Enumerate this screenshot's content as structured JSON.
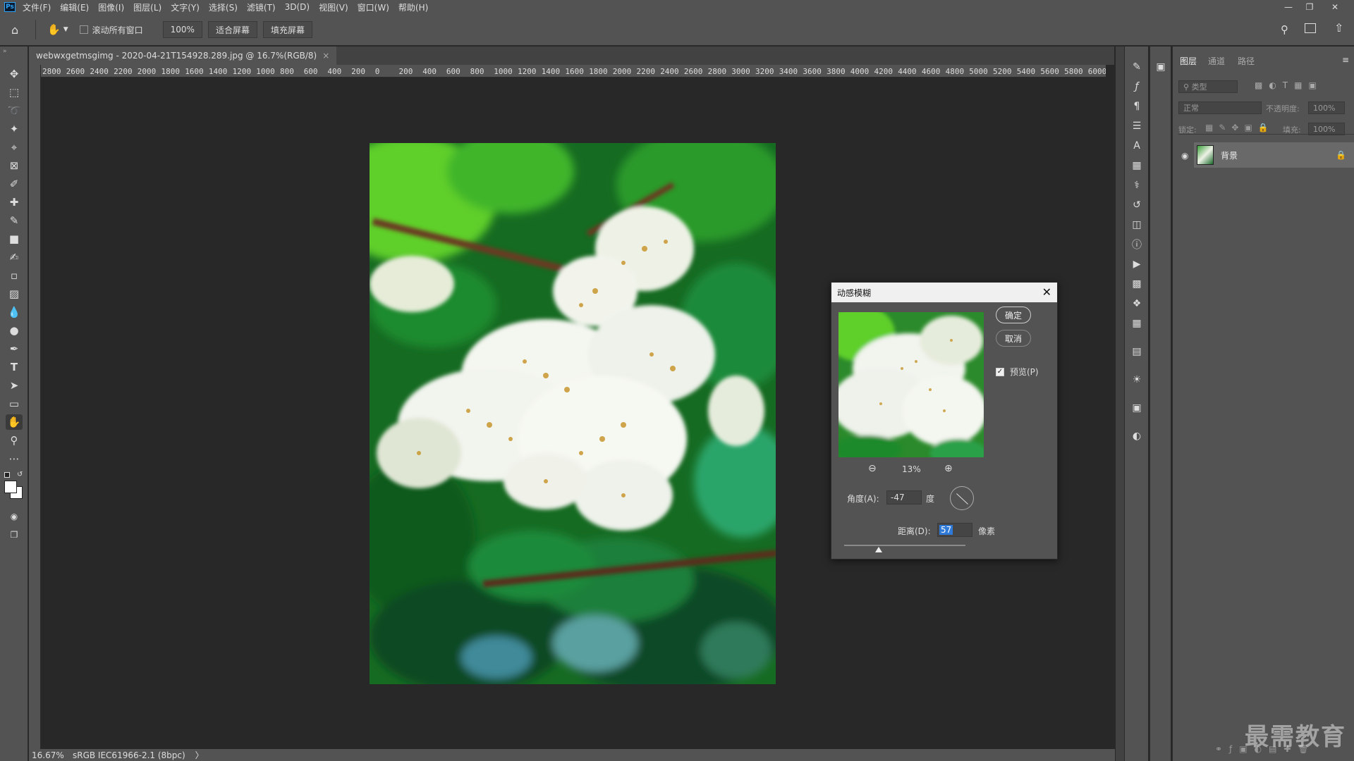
{
  "app": {
    "logo": "Ps",
    "menus": [
      "文件(F)",
      "编辑(E)",
      "图像(I)",
      "图层(L)",
      "文字(Y)",
      "选择(S)",
      "滤镜(T)",
      "3D(D)",
      "视图(V)",
      "窗口(W)",
      "帮助(H)"
    ]
  },
  "options": {
    "scroll_all_label": "滚动所有窗口",
    "zoom_value": "100%",
    "fit_screen": "适合屏幕",
    "fill_screen": "填充屏幕"
  },
  "document": {
    "tab_title": "webwxgetmsgimg - 2020-04-21T154928.289.jpg @ 16.7%(RGB/8)",
    "tab_close": "×"
  },
  "ruler": {
    "ticks": [
      "2800",
      "2600",
      "2400",
      "2200",
      "2000",
      "1800",
      "1600",
      "1400",
      "1200",
      "1000",
      "800",
      "600",
      "400",
      "200",
      "0",
      "200",
      "400",
      "600",
      "800",
      "1000",
      "1200",
      "1400",
      "1600",
      "1800",
      "2000",
      "2200",
      "2400",
      "2600",
      "2800",
      "3000",
      "3200",
      "3400",
      "3600",
      "3800",
      "4000",
      "4200",
      "4400",
      "4600",
      "4800",
      "5000",
      "5200",
      "5400",
      "5600",
      "5800",
      "6000",
      "6"
    ]
  },
  "status": {
    "zoom": "16.67%",
    "profile": "sRGB IEC61966-2.1 (8bpc)",
    "arrow": "〉"
  },
  "layers_panel": {
    "tabs": [
      "图层",
      "通道",
      "路径"
    ],
    "search_placeholder": "类型",
    "blend_mode": "正常",
    "opacity_label": "不透明度:",
    "opacity_value": "100%",
    "lock_label": "锁定:",
    "fill_label": "填充:",
    "fill_value": "100%",
    "layer_name": "背景"
  },
  "dialog": {
    "title": "动感模糊",
    "ok": "确定",
    "cancel": "取消",
    "preview_label": "预览(P)",
    "zoom": "13%",
    "angle_label": "角度(A):",
    "angle_value": "-47",
    "angle_unit": "度",
    "distance_label": "距离(D):",
    "distance_value": "57",
    "distance_unit": "像素",
    "distance_slider_fraction": 0.285
  },
  "watermark": "最需教育"
}
